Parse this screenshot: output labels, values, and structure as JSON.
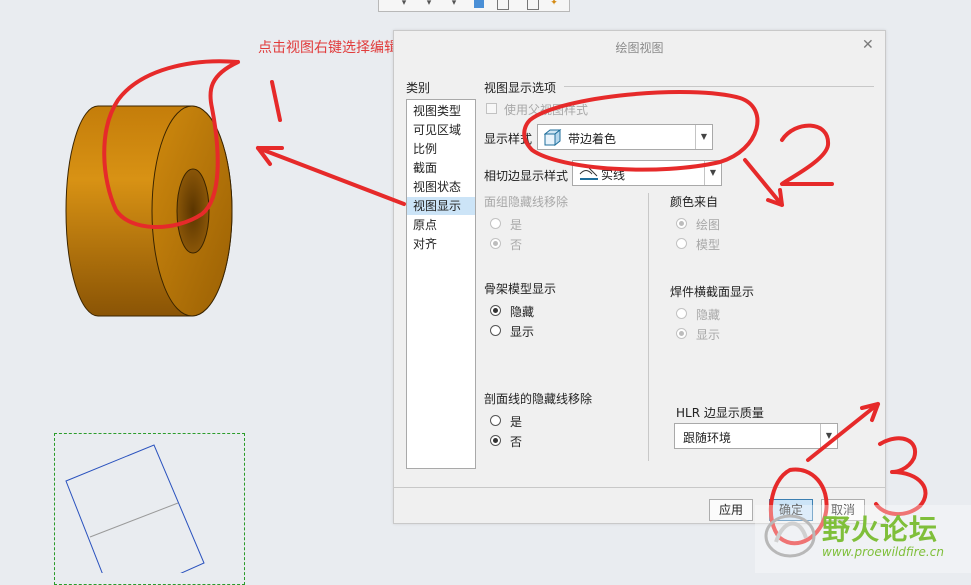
{
  "annotation": {
    "caption": "点击视图右键选择编辑视图",
    "numbers": [
      "1",
      "2",
      "3"
    ]
  },
  "dialog": {
    "title": "绘图视图",
    "categories_label": "类别",
    "categories": [
      "视图类型",
      "可见区域",
      "比例",
      "截面",
      "视图状态",
      "视图显示",
      "原点",
      "对齐"
    ],
    "selected_category": "视图显示",
    "display_options": {
      "section_title": "视图显示选项",
      "use_parent_style_label": "使用父视图样式",
      "display_style_label": "显示样式",
      "display_style_value": "带边着色",
      "tangent_edge_label": "相切边显示样式",
      "tangent_edge_value": "实线"
    },
    "face_group_hidden": {
      "title": "面组隐藏线移除",
      "options": [
        "是",
        "否"
      ],
      "selected": "否"
    },
    "color_from": {
      "title": "颜色来自",
      "options": [
        "绘图",
        "模型"
      ],
      "selected": "绘图"
    },
    "skeleton_display": {
      "title": "骨架模型显示",
      "options": [
        "隐藏",
        "显示"
      ],
      "selected": "隐藏"
    },
    "weld_section_display": {
      "title": "焊件横截面显示",
      "options": [
        "隐藏",
        "显示"
      ],
      "selected": "显示"
    },
    "section_hidden_line": {
      "title": "剖面线的隐藏线移除",
      "options": [
        "是",
        "否"
      ],
      "selected": "否"
    },
    "hlr_quality": {
      "label": "HLR 边显示质量",
      "value": "跟随环境"
    },
    "buttons": {
      "apply": "应用",
      "ok": "确定",
      "cancel": "取消"
    }
  },
  "watermark": {
    "text": "野火论坛",
    "url": "www.proewildfire.cn"
  },
  "colors": {
    "annotation_red": "#e13b3b",
    "cylinder_orange": "#c9860e",
    "selection_blue": "#cce4f7",
    "frame_green": "#2a9c2a",
    "watermark_green": "#7fbf3a"
  }
}
